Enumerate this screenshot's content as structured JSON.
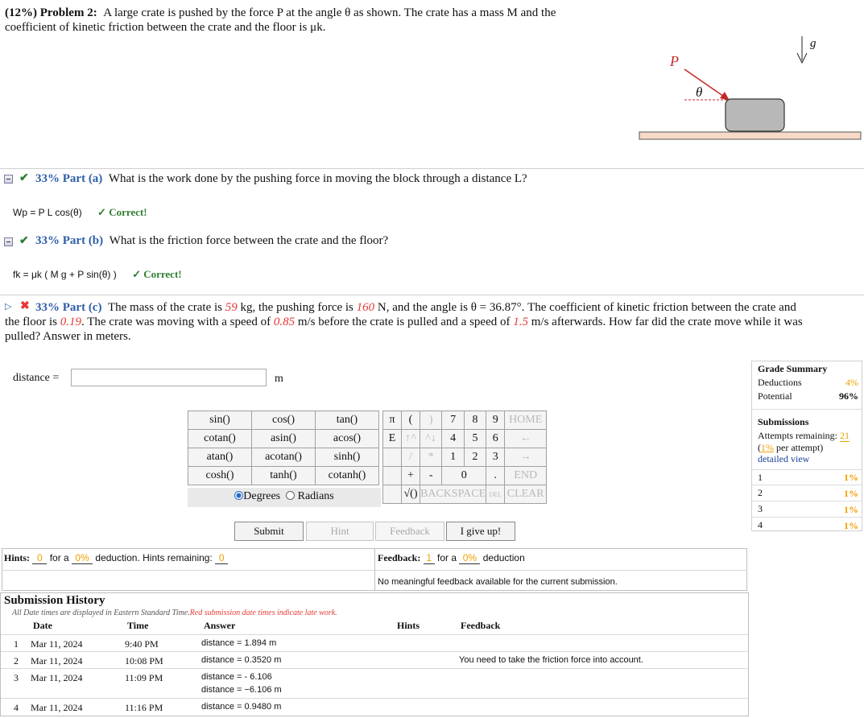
{
  "problem": {
    "label": "(12%) Problem 2:",
    "line1": "A large crate is pushed by the force P at the angle θ as shown. The crate has a mass M and the",
    "line2": "coefficient of kinetic friction between the crate and the floor is μk."
  },
  "figure": {
    "force_label": "P",
    "angle_label": "θ",
    "gravity_label": "g"
  },
  "part_a": {
    "percent": "33% Part (a)",
    "question": "What is the work done by the pushing force in moving the block through a distance L?",
    "answer": "Wp = P L cos(θ)",
    "status": "✓ Correct!"
  },
  "part_b": {
    "percent": "33% Part (b)",
    "question": "What is the friction force between the crate and the floor?",
    "answer": "fk = μk ( M g + P sin(θ) )",
    "status": "✓ Correct!"
  },
  "part_c": {
    "percent": "33% Part (c)",
    "t1": "The mass of the crate is ",
    "mass": "59",
    "t2": " kg, the pushing force is ",
    "force": "160",
    "t3": " N, and the angle is θ = 36.87°. The coefficient of kinetic friction between the crate and",
    "t4": "the floor is ",
    "mu": "0.19",
    "t5": ". The crate was moving with a speed of ",
    "v1": "0.85",
    "t6": " m/s before the crate is pulled and a speed of ",
    "v2": "1.5",
    "t7": " m/s afterwards. How far did the crate move while it was",
    "t8": "pulled? Answer in meters."
  },
  "answer_input": {
    "label": "distance =",
    "value": "",
    "unit": "m"
  },
  "calculator": {
    "functions": [
      [
        "sin()",
        "cos()",
        "tan()"
      ],
      [
        "cotan()",
        "asin()",
        "acos()"
      ],
      [
        "atan()",
        "acotan()",
        "sinh()"
      ],
      [
        "cosh()",
        "tanh()",
        "cotanh()"
      ]
    ],
    "symbols": [
      "π",
      "(",
      ")",
      "E",
      "↑^",
      "^↓",
      "/",
      "*",
      "+",
      "-"
    ],
    "digits": [
      "7",
      "8",
      "9",
      "4",
      "5",
      "6",
      "1",
      "2",
      "3",
      "0",
      "."
    ],
    "controls": {
      "home": "HOME",
      "back_arrow": "←",
      "fwd_arrow": "→",
      "end": "END",
      "sqrt": "√()",
      "backspace": "BACKSPACE",
      "del": "DEL",
      "clear": "CLEAR"
    },
    "degrees": "Degrees",
    "radians": "Radians"
  },
  "buttons": {
    "submit": "Submit",
    "hint": "Hint",
    "feedback": "Feedback",
    "give_up": "I give up!"
  },
  "hints": {
    "label": "Hints:",
    "count": "0",
    "for_a": "for a",
    "pct": "0%",
    "deduction": "deduction. Hints remaining:",
    "remaining": "0"
  },
  "feedback": {
    "label": "Feedback:",
    "count": "1",
    "for_a": "for a",
    "pct": "0%",
    "deduction": "deduction",
    "message": "No meaningful feedback available for the current submission."
  },
  "grade": {
    "title": "Grade Summary",
    "deductions_label": "Deductions",
    "deductions": "4%",
    "potential_label": "Potential",
    "potential": "96%",
    "submissions_title": "Submissions",
    "attempts_label": "Attempts remaining:",
    "attempts": "21",
    "per_attempt_pct": "1%",
    "per_attempt": "per attempt)",
    "detailed": "detailed view",
    "rows": [
      {
        "n": "1",
        "v": "1%"
      },
      {
        "n": "2",
        "v": "1%"
      },
      {
        "n": "3",
        "v": "1%"
      },
      {
        "n": "4",
        "v": "1%"
      }
    ]
  },
  "history": {
    "title": "Submission History",
    "note": "All Date times are displayed in Eastern Standard Time.",
    "note_red": "Red submission date times indicate late work.",
    "headers": {
      "date": "Date",
      "time": "Time",
      "answer": "Answer",
      "hints": "Hints",
      "feedback": "Feedback"
    },
    "rows": [
      {
        "n": "1",
        "date": "Mar 11, 2024",
        "time": "9:40 PM",
        "answer": "distance = 1.894 m",
        "answer2": "",
        "feedback": ""
      },
      {
        "n": "2",
        "date": "Mar 11, 2024",
        "time": "10:08 PM",
        "answer": "distance = 0.3520 m",
        "answer2": "",
        "feedback": "You need to take the friction force into account."
      },
      {
        "n": "3",
        "date": "Mar 11, 2024",
        "time": "11:09 PM",
        "answer": "distance = - 6.106",
        "answer2": "distance = −6.106 m",
        "feedback": ""
      },
      {
        "n": "4",
        "date": "Mar 11, 2024",
        "time": "11:16 PM",
        "answer": "distance = 0.9480 m",
        "answer2": "",
        "feedback": ""
      }
    ]
  }
}
